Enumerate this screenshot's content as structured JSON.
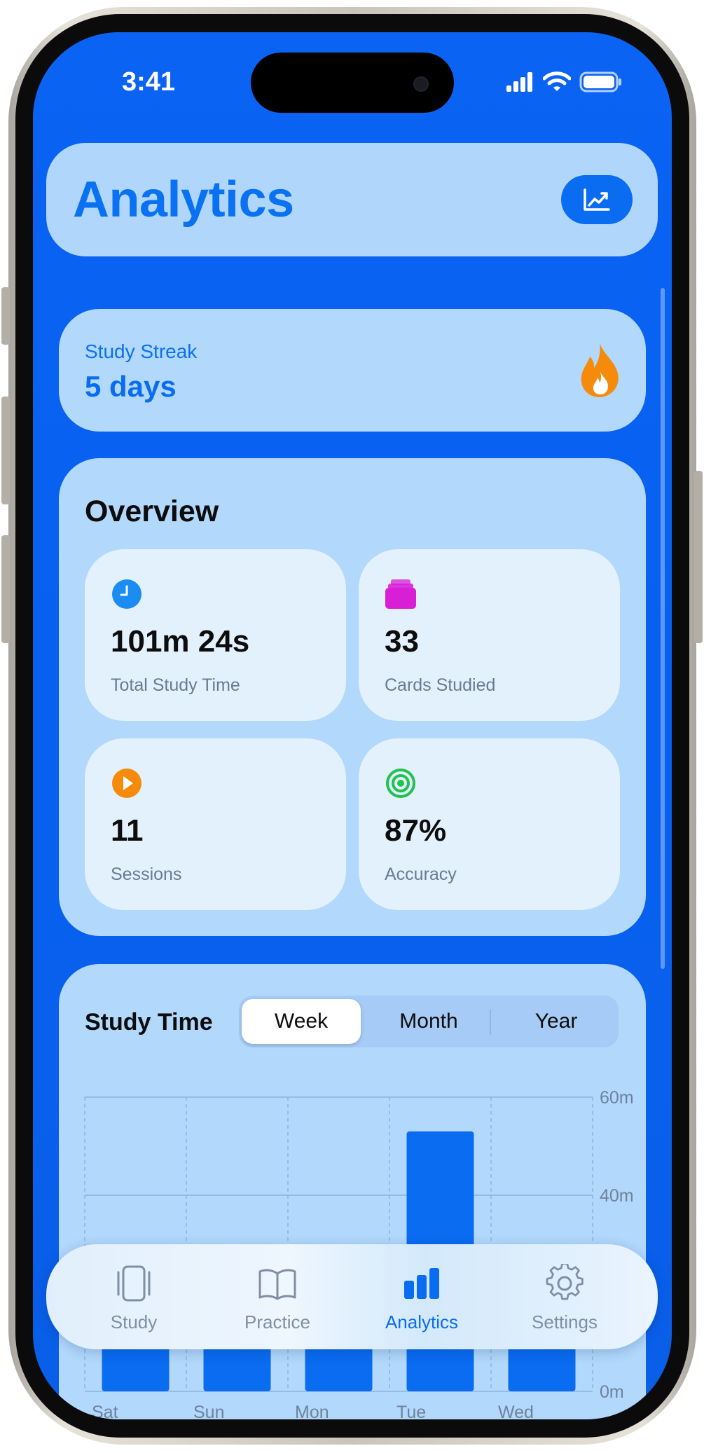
{
  "status_bar": {
    "time": "3:41"
  },
  "header": {
    "title": "Analytics",
    "action_icon": "chart-line-icon"
  },
  "streak": {
    "label": "Study Streak",
    "value": "5 days",
    "icon": "flame-icon"
  },
  "overview": {
    "title": "Overview",
    "tiles": [
      {
        "value": "101m 24s",
        "label": "Total Study Time",
        "icon": "clock-icon",
        "color": "#1a8cf2"
      },
      {
        "value": "33",
        "label": "Cards Studied",
        "icon": "cards-stack-icon",
        "color": "#d81fd6"
      },
      {
        "value": "11",
        "label": "Sessions",
        "icon": "play-circle-icon",
        "color": "#f58a0b"
      },
      {
        "value": "87%",
        "label": "Accuracy",
        "icon": "target-icon",
        "color": "#22c150"
      }
    ]
  },
  "study_time": {
    "title": "Study Time",
    "segments": [
      "Week",
      "Month",
      "Year"
    ],
    "selected_segment": "Week"
  },
  "chart_data": {
    "type": "bar",
    "categories": [
      "Sat",
      "Sun",
      "Mon",
      "Tue",
      "Wed"
    ],
    "values": [
      12,
      27,
      13,
      53,
      15
    ],
    "ylim": [
      0,
      60
    ],
    "yticks": [
      "0m",
      "20m",
      "40m",
      "60m"
    ],
    "unit": "m",
    "grid": true,
    "color": "#0a6cf1"
  },
  "tabbar": {
    "items": [
      {
        "label": "Study",
        "icon": "cards-icon",
        "active": false
      },
      {
        "label": "Practice",
        "icon": "book-icon",
        "active": false
      },
      {
        "label": "Analytics",
        "icon": "bar-chart-icon",
        "active": true
      },
      {
        "label": "Settings",
        "icon": "gear-icon",
        "active": false
      }
    ]
  },
  "colors": {
    "background": "#0760f0",
    "card": "#b2d8fc",
    "tile": "#e3f1fd",
    "accent": "#0a6cf1",
    "flame": "#f58a0b"
  }
}
